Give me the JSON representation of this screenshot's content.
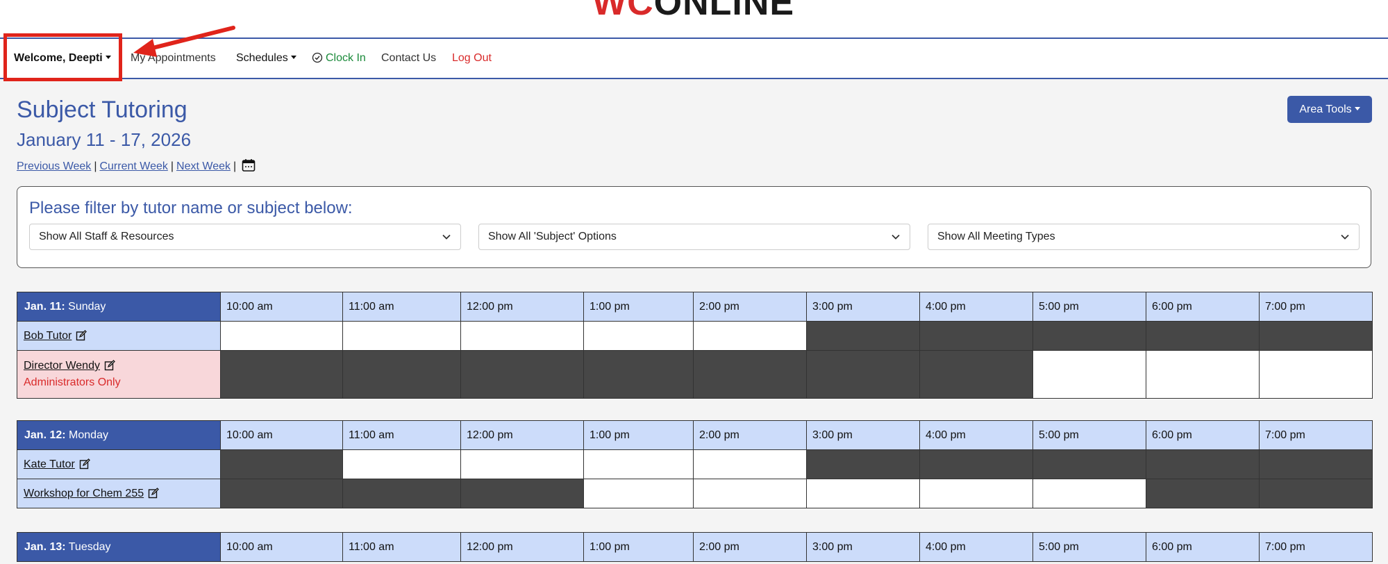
{
  "logo": {
    "part1": "WC",
    "part2": "ONLINE"
  },
  "nav": {
    "welcome": "Welcome, Deepti",
    "my_appointments": "My Appointments",
    "schedules": "Schedules",
    "clock_in": "Clock In",
    "contact_us": "Contact Us",
    "log_out": "Log Out"
  },
  "header": {
    "title": "Subject Tutoring",
    "date_range": "January 11 - 17, 2026",
    "previous_week": "Previous Week",
    "current_week": "Current Week",
    "next_week": "Next Week",
    "separator": "|",
    "area_tools": "Area Tools"
  },
  "filter": {
    "heading": "Please filter by tutor name or subject below:",
    "staff": "Show All Staff & Resources",
    "subject": "Show All 'Subject' Options",
    "meeting": "Show All Meeting Types"
  },
  "times": [
    "10:00 am",
    "11:00 am",
    "12:00 pm",
    "1:00 pm",
    "2:00 pm",
    "3:00 pm",
    "4:00 pm",
    "5:00 pm",
    "6:00 pm",
    "7:00 pm"
  ],
  "days": [
    {
      "date": "Jan. 11:",
      "weekday": "Sunday",
      "rows": [
        {
          "name": "Bob Tutor",
          "note": "",
          "slots": [
            "open",
            "open",
            "open",
            "open",
            "open",
            "closed",
            "closed",
            "closed",
            "closed",
            "closed"
          ]
        },
        {
          "name": "Director Wendy",
          "note": "Administrators Only",
          "slots": [
            "closed",
            "closed",
            "closed",
            "closed",
            "closed",
            "closed",
            "closed",
            "open",
            "open",
            "open"
          ]
        }
      ]
    },
    {
      "date": "Jan. 12:",
      "weekday": "Monday",
      "rows": [
        {
          "name": "Kate Tutor",
          "note": "",
          "slots": [
            "closed",
            "open",
            "open",
            "open",
            "open",
            "closed",
            "closed",
            "closed",
            "closed",
            "closed"
          ]
        },
        {
          "name": "Workshop for Chem 255",
          "note": "",
          "slots": [
            "closed",
            "closed",
            "closed",
            "open",
            "open",
            "open",
            "open",
            "open",
            "closed",
            "closed"
          ]
        }
      ]
    },
    {
      "date": "Jan. 13:",
      "weekday": "Tuesday",
      "rows": []
    }
  ],
  "colors": {
    "brand_blue": "#3b59a7",
    "header_light": "#ccdcfa",
    "closed": "#474747",
    "annotation": "#e0241b",
    "clock_green": "#1a8a3a",
    "logout_red": "#d92a2a"
  }
}
